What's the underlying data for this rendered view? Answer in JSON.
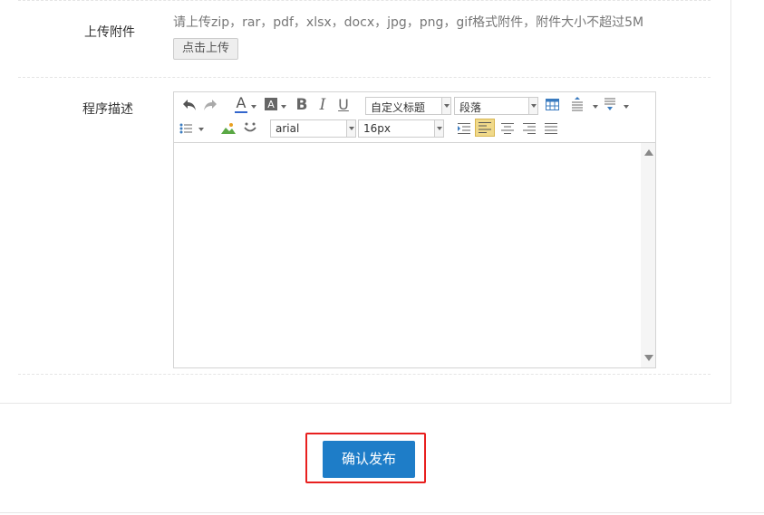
{
  "attachment": {
    "label": "上传附件",
    "hint": "请上传zip，rar，pdf，xlsx，docx，jpg，png，gif格式附件，附件大小不超过5M",
    "upload_button": "点击上传"
  },
  "description": {
    "label": "程序描述"
  },
  "editor": {
    "toolbar": {
      "heading_select": "自定义标题",
      "paragraph_select": "段落",
      "font_family_select": "arial",
      "font_size_select": "16px",
      "font_color_glyph": "A",
      "bg_color_glyph": "A",
      "bold_glyph": "B",
      "italic_glyph": "I",
      "underline_glyph": "U"
    },
    "active_alignment": "left",
    "accent_color": "#f0d98a"
  },
  "submit": {
    "label": "确认发布",
    "color": "#1e7dc8",
    "highlight_color": "#e8201f"
  }
}
